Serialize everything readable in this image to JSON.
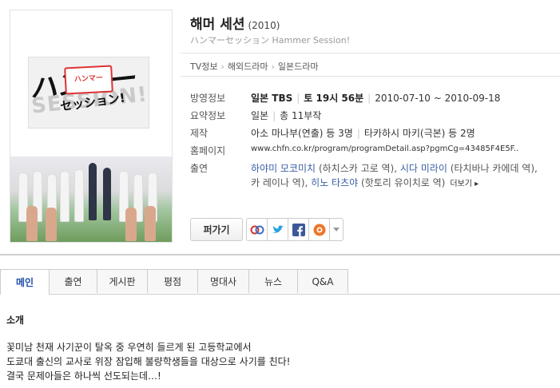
{
  "poster": {
    "logo_jp": "ハンマー",
    "logo_jp2": "セッション!",
    "logo_en": "SESSION!",
    "sign": "ハンマー"
  },
  "header": {
    "title": "해머 세션",
    "year": "(2010)",
    "subtitle": "ハンマーセッション Hammer Session!"
  },
  "breadcrumb": [
    "TV정보",
    "해외드라마",
    "일본드라마"
  ],
  "info": {
    "broadcast": {
      "label": "방영정보",
      "channel": "일본 TBS",
      "schedule": "토 19시 56분",
      "period": "2010-07-10 ~ 2010-09-18"
    },
    "summary": {
      "label": "요약정보",
      "country": "일본",
      "episodes": "총 11부작"
    },
    "production": {
      "label": "제작",
      "director": "아소 마나부(연출) 등 3명",
      "writer": "타카하시 마키(극본) 등 2명"
    },
    "homepage": {
      "label": "홈페이지",
      "url": "www.chfn.co.kr/program/programDetail.asp?pgmCg=43485F4E5F.."
    },
    "cast": {
      "label": "출연",
      "actor1": "하야미 모코미치",
      "role1": "(하치스카 고로 역),",
      "actor2": "시다 미라이",
      "role2": "(타치바나 카에데 역),",
      "role3": "카 레이나 역),",
      "actor3": "히노 타츠야",
      "role4": "(핫토리 유이치로 역)",
      "more": "더보기 ▸"
    }
  },
  "actions": {
    "share": "퍼가기",
    "icons": [
      "link-share-icon",
      "twitter-icon",
      "facebook-icon",
      "blog-icon",
      "dropdown-arrow-icon"
    ]
  },
  "tabs": [
    "메인",
    "출연",
    "게시판",
    "평점",
    "명대사",
    "뉴스",
    "Q&A"
  ],
  "content": {
    "section_title": "소개",
    "lines": [
      "꽃미남 천재 사기꾼이 탈옥 중 우연히 들르게 된 고등학교에서",
      "도쿄대 출신의 교사로 위장 잠입해 불량학생들을 대상으로 사기를 친다!",
      "결국 문제아들은 하나씩 선도되는데…!"
    ]
  },
  "colors": {
    "link": "#3a5fa5",
    "active_tab": "#1f4da8",
    "twitter": "#2aa3dd",
    "facebook": "#3b5998",
    "blog": "#f07427"
  }
}
